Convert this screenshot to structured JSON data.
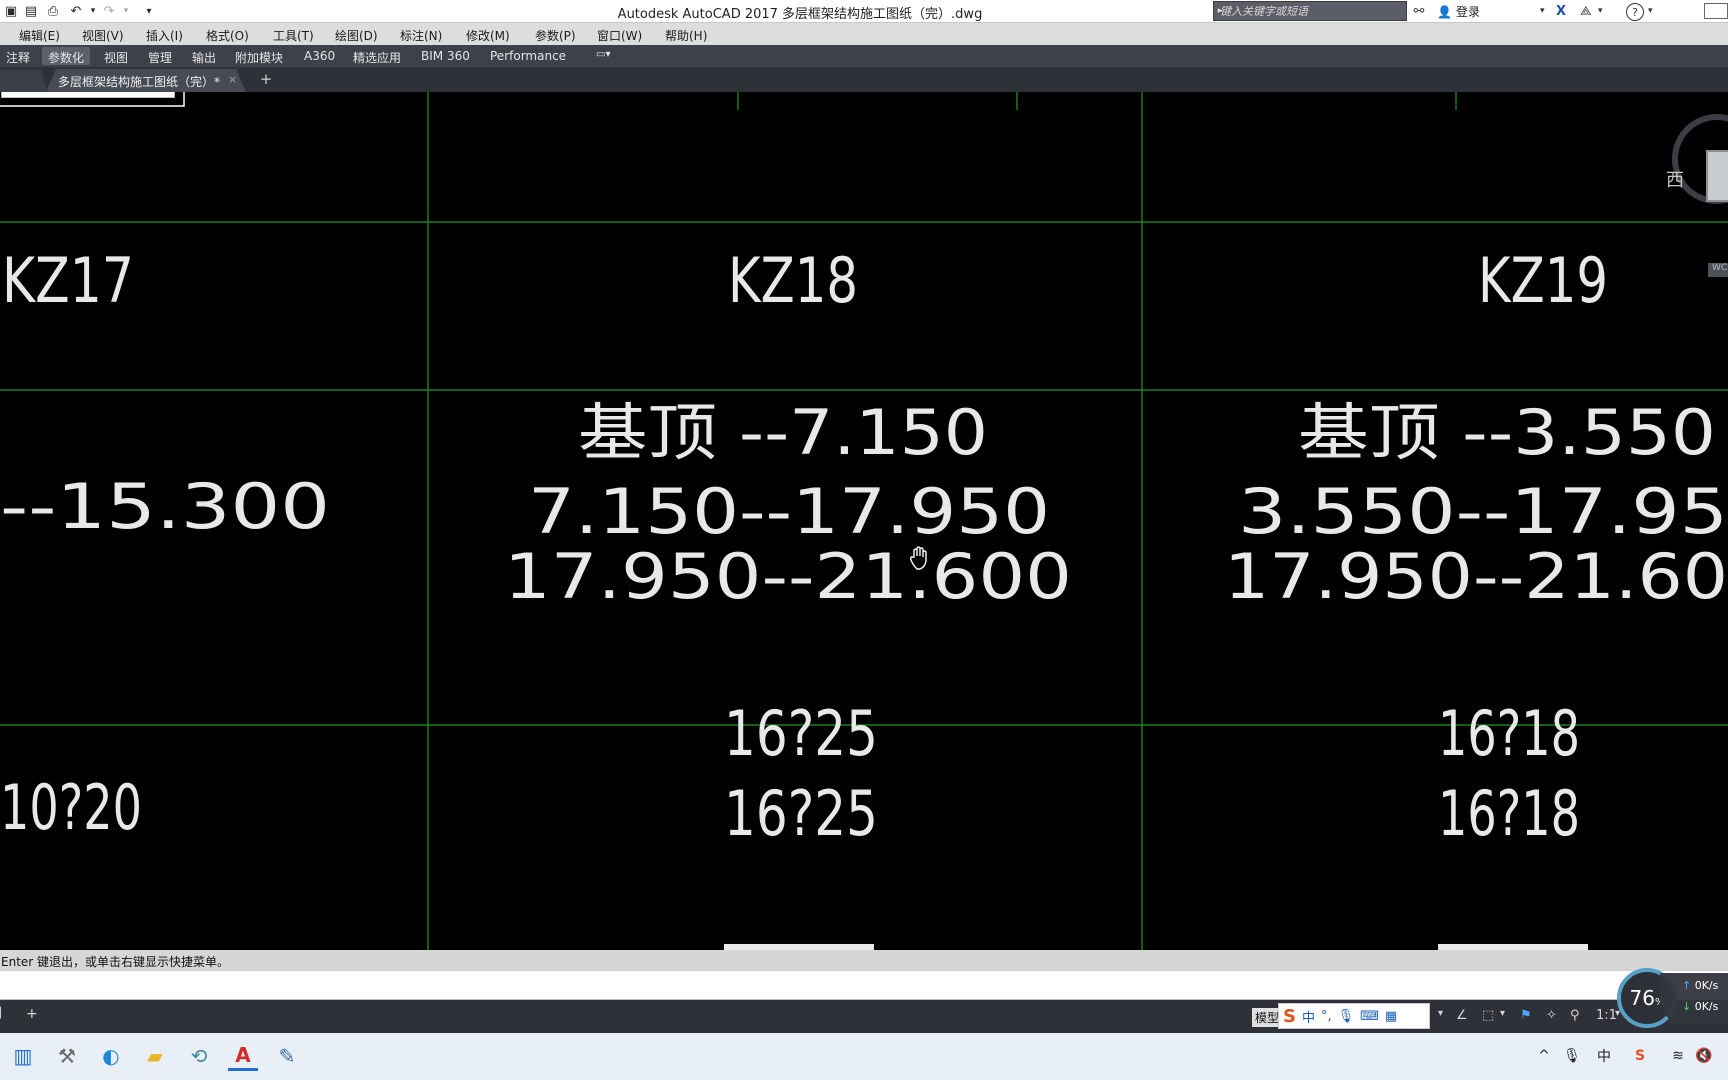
{
  "window": {
    "title": "Autodesk AutoCAD 2017    多层框架结构施工图纸（完）.dwg",
    "search_placeholder": "键入关键字或短语",
    "login_label": "登录"
  },
  "menubar": {
    "items": [
      "编辑(E)",
      "视图(V)",
      "插入(I)",
      "格式(O)",
      "工具(T)",
      "绘图(D)",
      "标注(N)",
      "修改(M)",
      "参数(P)",
      "窗口(W)",
      "帮助(H)"
    ]
  },
  "ribbon": {
    "tabs": [
      "注释",
      "参数化",
      "视图",
      "管理",
      "输出",
      "附加模块",
      "A360",
      "精选应用",
      "BIM 360",
      "Performance"
    ],
    "active_tab": "参数化"
  },
  "file_tabs": {
    "document": "多层框架结构施工图纸（完）*",
    "close_symbol": "×",
    "new_symbol": "+"
  },
  "drawing": {
    "columns": [
      {
        "name": "KZ17",
        "elevations": [
          "--15.300"
        ],
        "rebar": [
          "10?20"
        ]
      },
      {
        "name": "KZ18",
        "elevations": [
          "基顶 --7.150",
          "7.150--17.950",
          "17.950--21.600"
        ],
        "rebar": [
          "16?25",
          "16?25"
        ]
      },
      {
        "name": "KZ19",
        "elevations": [
          "基顶 --3.550",
          "3.550--17.95",
          "17.950--21.60"
        ],
        "rebar": [
          "16?18",
          "16?18"
        ]
      }
    ],
    "grid_color": "#1f9a1f",
    "text_color": "#e8e8e8"
  },
  "viewcube": {
    "west_label": "西",
    "wcs_label": "WC"
  },
  "command": {
    "history": "Enter 键退出，或单击右键显示快捷菜单。"
  },
  "statusbar": {
    "model_label": "模型",
    "scale": "1:1",
    "ime_lang": "中",
    "cpu_percent": "76",
    "cpu_unit": "%",
    "net_up": "0K/s",
    "net_down": "0K/s"
  },
  "taskbar": {
    "apps": [
      "windows-start",
      "tools",
      "edge",
      "file-explorer",
      "sync",
      "autocad",
      "notes"
    ]
  }
}
